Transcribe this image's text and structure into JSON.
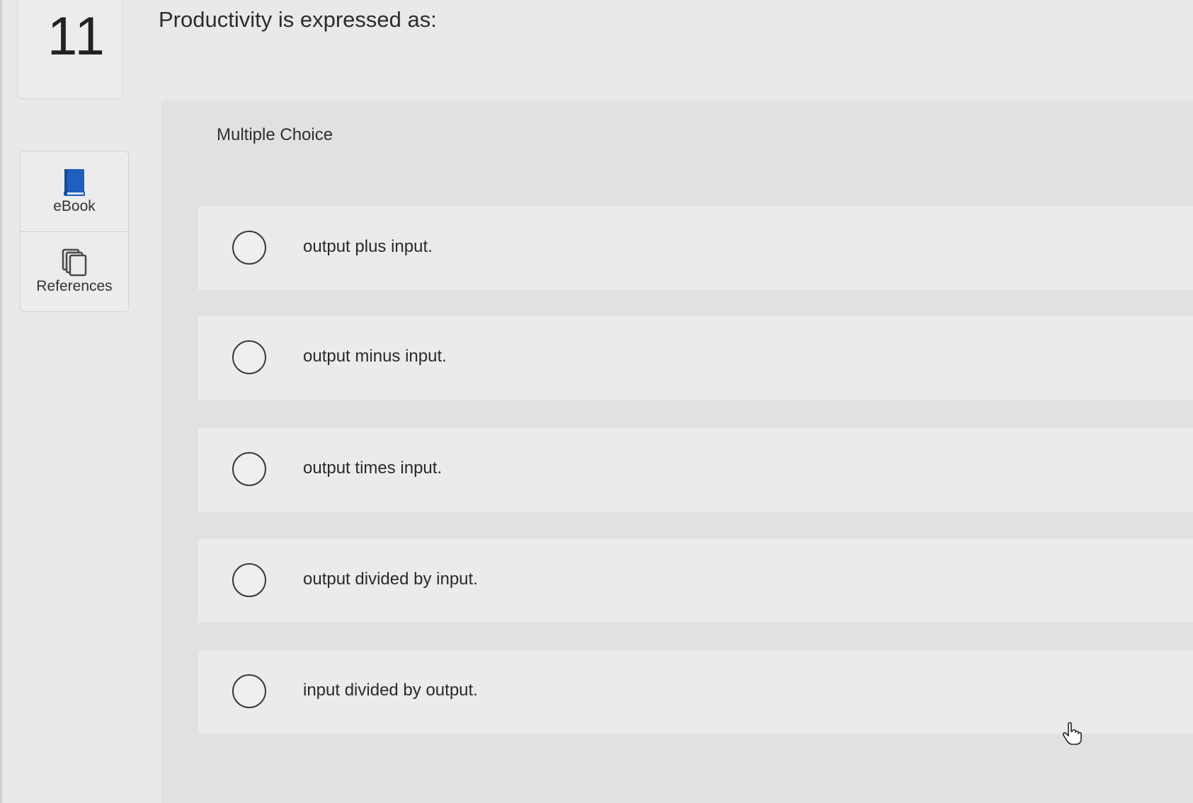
{
  "question": {
    "number": "11",
    "text": "Productivity is expressed as:"
  },
  "tools": {
    "ebook": {
      "label": "eBook",
      "icon": "book-icon",
      "color": "#1e5fbf"
    },
    "references": {
      "label": "References",
      "icon": "documents-icon"
    }
  },
  "answer_area": {
    "type_label": "Multiple Choice",
    "choices": [
      {
        "label": "output plus input.",
        "selected": false
      },
      {
        "label": "output minus input.",
        "selected": false
      },
      {
        "label": "output times input.",
        "selected": false
      },
      {
        "label": "output divided by input.",
        "selected": false
      },
      {
        "label": "input divided by output.",
        "selected": false
      }
    ]
  },
  "cursor": {
    "icon": "hand-pointer-icon"
  }
}
